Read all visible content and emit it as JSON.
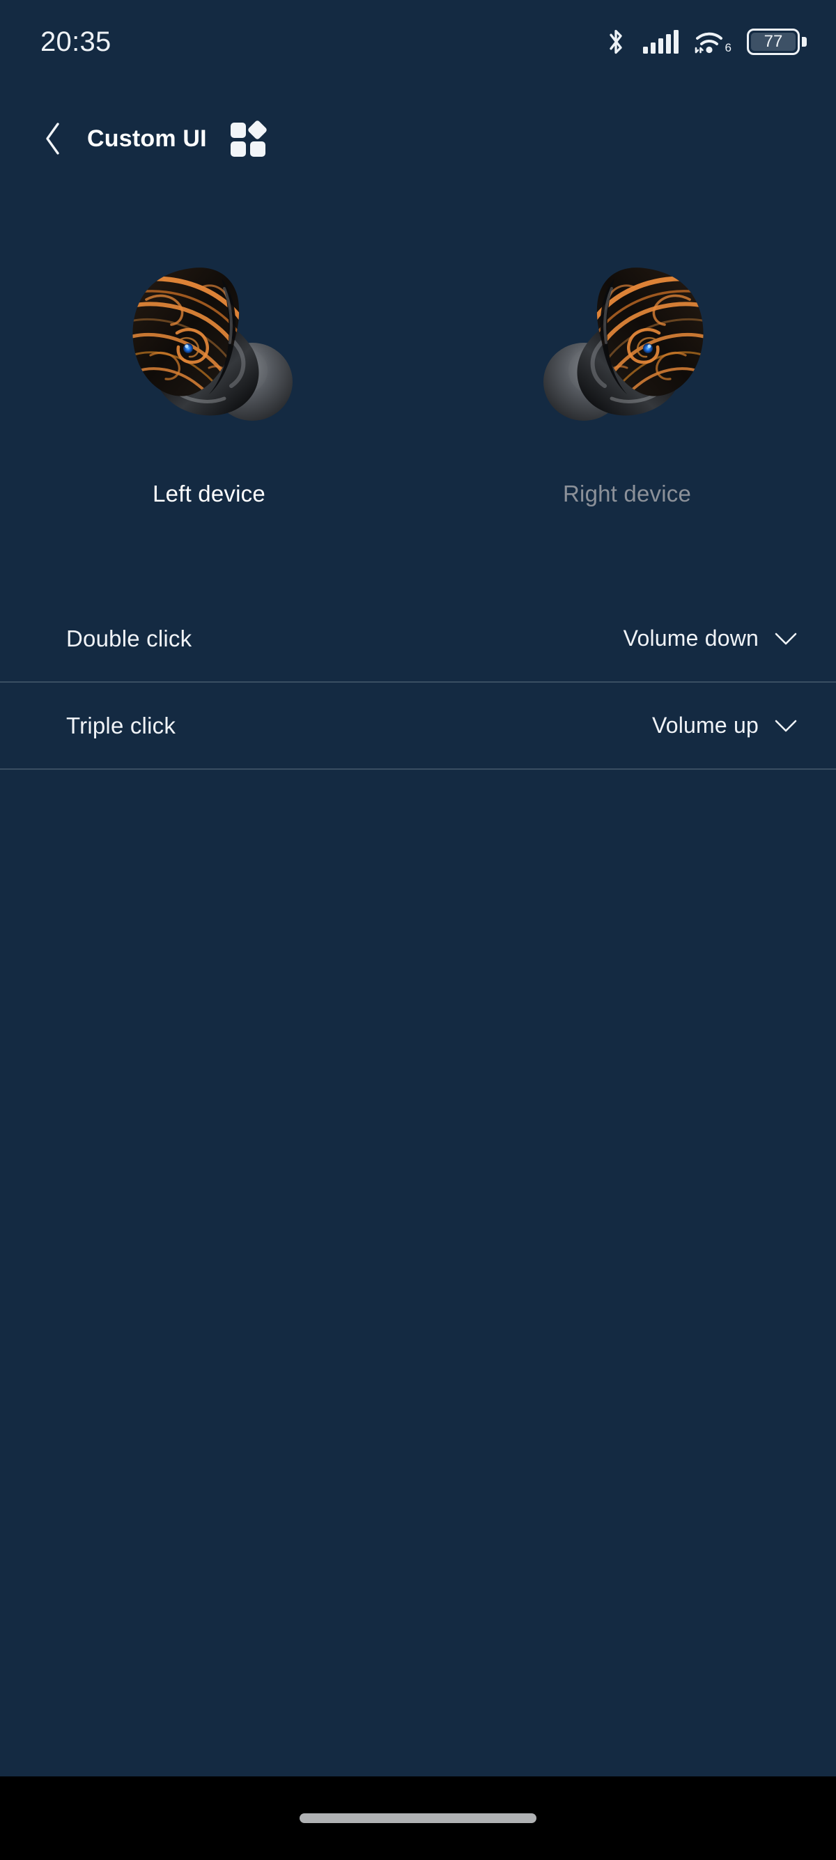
{
  "status_bar": {
    "time": "20:35",
    "bluetooth_icon": "bluetooth-icon",
    "signal_icon": "cellular-signal-icon",
    "signal_bars": 5,
    "wifi_icon": "wifi-icon",
    "wifi_generation": "6",
    "battery_icon": "battery-icon",
    "battery_level": "77"
  },
  "app_bar": {
    "back_icon": "chevron-left-icon",
    "title": "Custom UI",
    "grid_icon": "grid-apps-icon"
  },
  "devices": [
    {
      "label": "Left device",
      "side": "left",
      "selected": true
    },
    {
      "label": "Right device",
      "side": "right",
      "selected": false
    }
  ],
  "settings": {
    "rows": [
      {
        "label": "Double click",
        "value": "Volume down",
        "chevron_icon": "chevron-down-icon"
      },
      {
        "label": "Triple click",
        "value": "Volume up",
        "chevron_icon": "chevron-down-icon"
      }
    ]
  },
  "nav_bar": {
    "home_indicator": "home-indicator-pill"
  },
  "colors": {
    "background": "#142a42",
    "text_primary": "#f0f3f7",
    "text_muted": "#8c9199",
    "divider": "#3a4e62",
    "accent_orange": "#e8893a",
    "led_blue": "#1f6fe0",
    "nav_background": "#000000"
  }
}
